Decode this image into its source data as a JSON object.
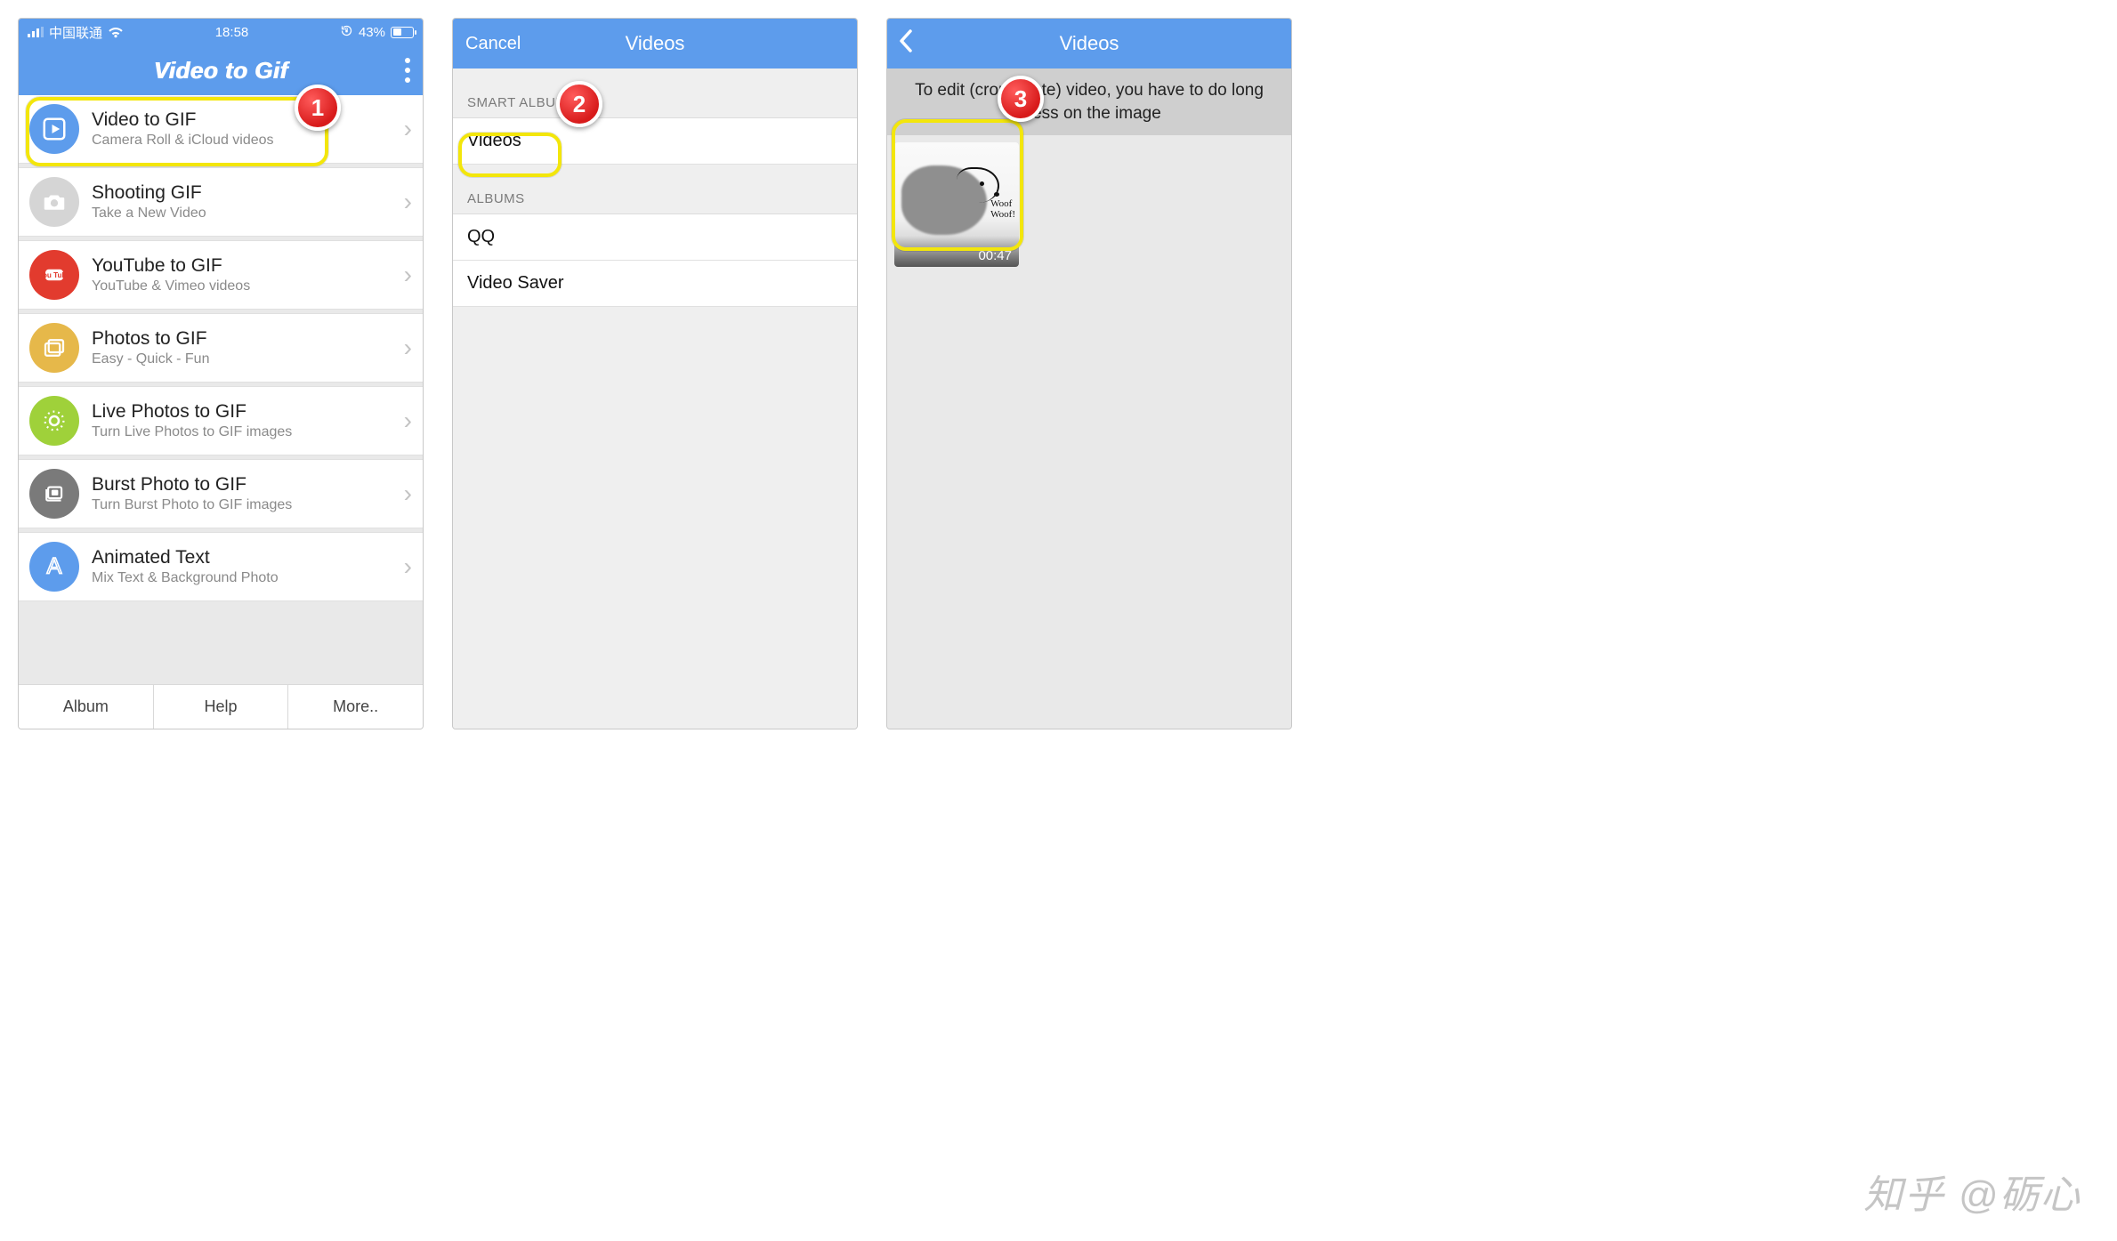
{
  "colors": {
    "accent": "#5d9cec",
    "highlight": "#f3e60b",
    "callout": "#d81b1b"
  },
  "screen1": {
    "status": {
      "carrier": "中国联通",
      "time": "18:58",
      "battery_pct": "43%"
    },
    "header": {
      "title": "Video to Gif"
    },
    "menu": [
      {
        "icon": "play",
        "color": "#5d9cec",
        "title": "Video to GIF",
        "sub": "Camera Roll & iCloud videos"
      },
      {
        "icon": "camera",
        "color": "#d5d5d5",
        "title": "Shooting GIF",
        "sub": "Take a New Video"
      },
      {
        "icon": "youtube",
        "color": "#e23b2e",
        "title": "YouTube to GIF",
        "sub": "YouTube & Vimeo videos"
      },
      {
        "icon": "photos",
        "color": "#e6b84a",
        "title": "Photos to GIF",
        "sub": "Easy - Quick - Fun"
      },
      {
        "icon": "live",
        "color": "#9fd13a",
        "title": "Live Photos to GIF",
        "sub": "Turn Live Photos to GIF images"
      },
      {
        "icon": "burst",
        "color": "#7a7a7a",
        "title": "Burst Photo to GIF",
        "sub": "Turn Burst Photo to GIF images"
      },
      {
        "icon": "text",
        "color": "#5d9cec",
        "title": "Animated Text",
        "sub": "Mix Text & Background Photo"
      }
    ],
    "bottom": {
      "album": "Album",
      "help": "Help",
      "more": "More.."
    },
    "callout": "1"
  },
  "screen2": {
    "nav": {
      "cancel": "Cancel",
      "title": "Videos"
    },
    "sections": [
      {
        "header": "SMART ALBUMS",
        "rows": [
          "Videos"
        ]
      },
      {
        "header": "ALBUMS",
        "rows": [
          "QQ",
          "Video Saver"
        ]
      }
    ],
    "callout": "2"
  },
  "screen3": {
    "nav": {
      "title": "Videos"
    },
    "hint": "To edit (crop/rotate) video, you have to do long press on the image",
    "thumbs": [
      {
        "duration": "00:47",
        "woof1": "Woof",
        "woof2": "Woof!"
      }
    ],
    "callout": "3"
  },
  "watermark": "知乎 @砺心"
}
